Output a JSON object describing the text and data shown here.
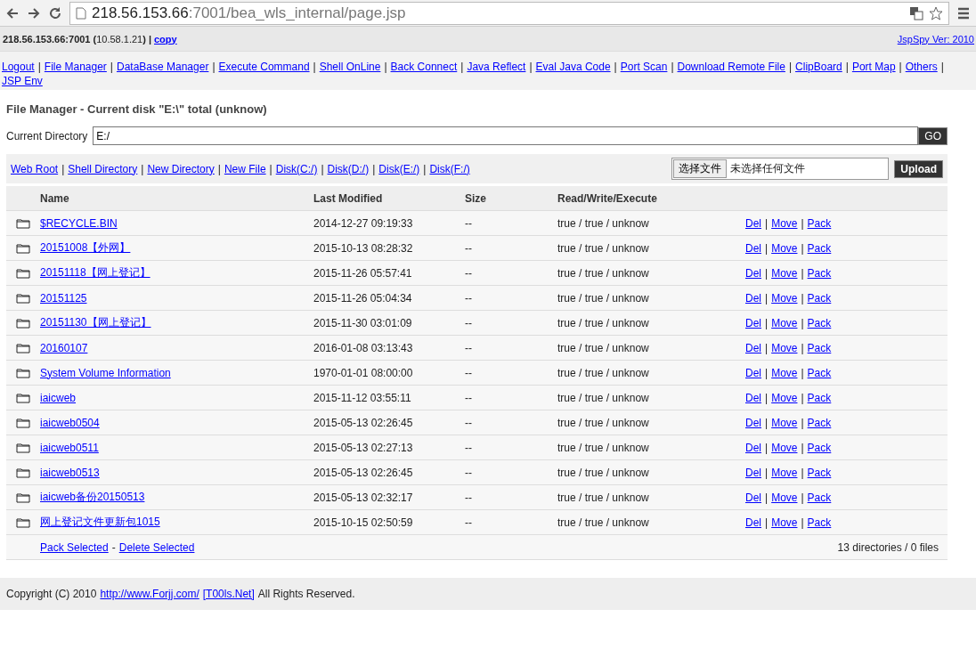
{
  "browser": {
    "url_host": "218.56.153.66",
    "url_rest": ":7001/bea_wls_internal/page.jsp"
  },
  "header": {
    "info": "**218.56.153.66:7001 (**10.58.1.21**) |**",
    "copy_link": "copy",
    "version_link": "JspSpy Ver: 2010"
  },
  "nav": [
    {
      "label": "Logout",
      "sep": "|"
    },
    {
      "label": "File Manager",
      "sep": "|"
    },
    {
      "label": "DataBase Manager",
      "sep": "|"
    },
    {
      "label": "Execute Command",
      "sep": "|"
    },
    {
      "label": "Shell OnLine",
      "sep": "|"
    },
    {
      "label": "Back Connect",
      "sep": "|"
    },
    {
      "label": "Java Reflect",
      "sep": "|"
    },
    {
      "label": "Eval Java Code",
      "sep": "|"
    },
    {
      "label": "Port Scan",
      "sep": "|"
    },
    {
      "label": "Download Remote File",
      "sep": "|"
    },
    {
      "label": "ClipBoard",
      "sep": "|"
    },
    {
      "label": "Port Map",
      "sep": "|"
    },
    {
      "label": "Others",
      "sep": "|"
    },
    {
      "label": "JSP Env"
    }
  ],
  "title": "File Manager - Current disk \"E:\\\" total (unknow)",
  "directory": {
    "label": "Current Directory",
    "value": "E:/",
    "button": "GO"
  },
  "toolbar": {
    "links": [
      {
        "label": "Web Root",
        "sep": "|"
      },
      {
        "label": "Shell Directory",
        "sep": "|"
      },
      {
        "label": "New Directory",
        "sep": "|"
      },
      {
        "label": "New File",
        "sep": "|"
      },
      {
        "label": "Disk(C:/)",
        "sep": "|"
      },
      {
        "label": "Disk(D:/)",
        "sep": "|"
      },
      {
        "label": "Disk(E:/)",
        "sep": "|"
      },
      {
        "label": "Disk(F:/)"
      }
    ],
    "choose_button": "选择文件",
    "no_file": "未选择任何文件",
    "upload_button": "Upload"
  },
  "table": {
    "columns": [
      "Name",
      "Last Modified",
      "Size",
      "Read/Write/Execute"
    ],
    "rows": [
      {
        "name": "$RECYCLE.BIN",
        "modified": "2014-12-27 09:19:33",
        "size": "--",
        "rwx": "true / true / unknow",
        "actions": [
          "Del",
          "Move",
          "Pack"
        ]
      },
      {
        "name": "20151008【外网】",
        "modified": "2015-10-13 08:28:32",
        "size": "--",
        "rwx": "true / true / unknow",
        "actions": [
          "Del",
          "Move",
          "Pack"
        ]
      },
      {
        "name": "20151118【网上登记】",
        "modified": "2015-11-26 05:57:41",
        "size": "--",
        "rwx": "true / true / unknow",
        "actions": [
          "Del",
          "Move",
          "Pack"
        ]
      },
      {
        "name": "20151125",
        "modified": "2015-11-26 05:04:34",
        "size": "--",
        "rwx": "true / true / unknow",
        "actions": [
          "Del",
          "Move",
          "Pack"
        ]
      },
      {
        "name": "20151130【网上登记】",
        "modified": "2015-11-30 03:01:09",
        "size": "--",
        "rwx": "true / true / unknow",
        "actions": [
          "Del",
          "Move",
          "Pack"
        ]
      },
      {
        "name": "20160107",
        "modified": "2016-01-08 03:13:43",
        "size": "--",
        "rwx": "true / true / unknow",
        "actions": [
          "Del",
          "Move",
          "Pack"
        ]
      },
      {
        "name": "System Volume Information",
        "modified": "1970-01-01 08:00:00",
        "size": "--",
        "rwx": "true / true / unknow",
        "actions": [
          "Del",
          "Move",
          "Pack"
        ]
      },
      {
        "name": "iaicweb",
        "modified": "2015-11-12 03:55:11",
        "size": "--",
        "rwx": "true / true / unknow",
        "actions": [
          "Del",
          "Move",
          "Pack"
        ]
      },
      {
        "name": "iaicweb0504",
        "modified": "2015-05-13 02:26:45",
        "size": "--",
        "rwx": "true / true / unknow",
        "actions": [
          "Del",
          "Move",
          "Pack"
        ]
      },
      {
        "name": "iaicweb0511",
        "modified": "2015-05-13 02:27:13",
        "size": "--",
        "rwx": "true / true / unknow",
        "actions": [
          "Del",
          "Move",
          "Pack"
        ]
      },
      {
        "name": "iaicweb0513",
        "modified": "2015-05-13 02:26:45",
        "size": "--",
        "rwx": "true / true / unknow",
        "actions": [
          "Del",
          "Move",
          "Pack"
        ]
      },
      {
        "name": "iaicweb备份20150513",
        "modified": "2015-05-13 02:32:17",
        "size": "--",
        "rwx": "true / true / unknow",
        "actions": [
          "Del",
          "Move",
          "Pack"
        ]
      },
      {
        "name": "网上登记文件更新包1015",
        "modified": "2015-10-15 02:50:59",
        "size": "--",
        "rwx": "true / true / unknow",
        "actions": [
          "Del",
          "Move",
          "Pack"
        ]
      }
    ],
    "action_sep": "|",
    "footer": {
      "pack_link": "Pack Selected",
      "dash": "-",
      "delete_link": "Delete Selected",
      "summary": "13 directories / 0 files"
    }
  },
  "copyright": {
    "text": "Copyright (C) 2010",
    "link1": "http://www.Forjj.com/",
    "link2": "[T00ls.Net]",
    "rest": "All Rights Reserved."
  }
}
